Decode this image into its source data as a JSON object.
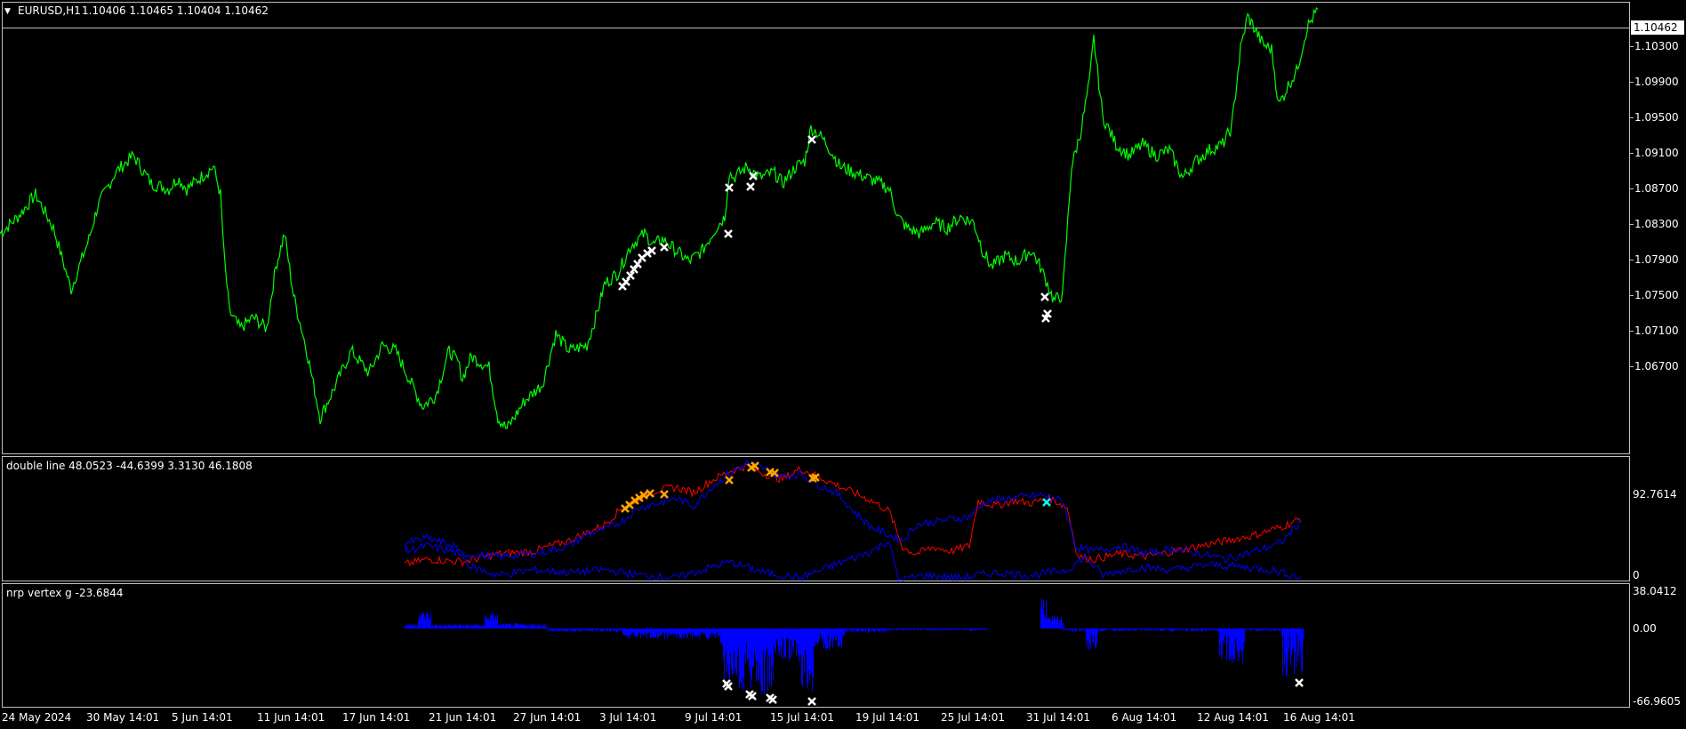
{
  "header": {
    "symbol_timeframe": "EURUSD,H1",
    "ohlc": "1.10406 1.10465 1.10404 1.10462"
  },
  "main_pane": {
    "current_price": "1.10462",
    "price_axis": [
      "1.10300",
      "1.09900",
      "1.09500",
      "1.09100",
      "1.08700",
      "1.08300",
      "1.07900",
      "1.07500",
      "1.07100",
      "1.06700"
    ],
    "line_color": "#00ff00"
  },
  "indicator1": {
    "title": "double line 48.0523 -44.6399 3.3130 46.1808",
    "axis_max": "92.7614",
    "axis_min": "0",
    "colors": {
      "red": "#ff0000",
      "blue": "#0000ff",
      "marker": "#ffa500",
      "cyan_marker": "#00ffff"
    }
  },
  "indicator2": {
    "title": "nrp vertex g -23.6844",
    "axis_max": "38.0412",
    "axis_mid": "0.00",
    "axis_min": "-66.9605",
    "histogram_color": "#0000ff"
  },
  "time_axis": [
    "24 May 2024",
    "30 May 14:01",
    "5 Jun 14:01",
    "11 Jun 14:01",
    "17 Jun 14:01",
    "21 Jun 14:01",
    "27 Jun 14:01",
    "3 Jul 14:01",
    "9 Jul 14:01",
    "15 Jul 14:01",
    "19 Jul 14:01",
    "25 Jul 14:01",
    "31 Jul 14:01",
    "6 Aug 14:01",
    "12 Aug 14:01",
    "16 Aug 14:01"
  ],
  "chart_data": [
    {
      "type": "line",
      "title": "EURUSD,H1",
      "ylim": [
        1.0648,
        1.1052
      ],
      "x": [
        "24 May 2024",
        "30 May 14:01",
        "5 Jun 14:01",
        "11 Jun 14:01",
        "17 Jun 14:01",
        "21 Jun 14:01",
        "27 Jun 14:01",
        "3 Jul 14:01",
        "9 Jul 14:01",
        "15 Jul 14:01",
        "19 Jul 14:01",
        "25 Jul 14:01",
        "31 Jul 14:01",
        "6 Aug 14:01",
        "12 Aug 14:01",
        "16 Aug 14:01"
      ],
      "series": [
        {
          "values": [
            1.0845,
            1.088,
            1.089,
            1.085,
            1.07,
            1.072,
            1.07,
            1.082,
            1.086,
            1.094,
            1.088,
            1.085,
            1.08,
            1.092,
            1.093,
            1.1046
          ]
        }
      ],
      "price_points": [
        [
          0,
          1.0845
        ],
        [
          20,
          1.086
        ],
        [
          40,
          1.088
        ],
        [
          60,
          1.085
        ],
        [
          80,
          1.0795
        ],
        [
          100,
          1.084
        ],
        [
          110,
          1.087
        ],
        [
          130,
          1.09
        ],
        [
          150,
          1.0915
        ],
        [
          170,
          1.089
        ],
        [
          190,
          1.0885
        ],
        [
          200,
          1.0895
        ],
        [
          210,
          1.0885
        ],
        [
          240,
          1.0905
        ],
        [
          248,
          1.088
        ],
        [
          252,
          1.0825
        ],
        [
          258,
          1.0775
        ],
        [
          270,
          1.076
        ],
        [
          285,
          1.077
        ],
        [
          300,
          1.076
        ],
        [
          310,
          1.0815
        ],
        [
          320,
          1.0845
        ],
        [
          330,
          1.079
        ],
        [
          345,
          1.074
        ],
        [
          360,
          1.068
        ],
        [
          375,
          1.0705
        ],
        [
          395,
          1.074
        ],
        [
          415,
          1.072
        ],
        [
          430,
          1.0745
        ],
        [
          445,
          1.074
        ],
        [
          460,
          1.0715
        ],
        [
          475,
          1.069
        ],
        [
          490,
          1.07
        ],
        [
          505,
          1.074
        ],
        [
          515,
          1.073
        ],
        [
          520,
          1.0715
        ],
        [
          530,
          1.0735
        ],
        [
          550,
          1.0725
        ],
        [
          560,
          1.068
        ],
        [
          570,
          1.067
        ],
        [
          590,
          1.0695
        ],
        [
          610,
          1.071
        ],
        [
          625,
          1.0755
        ],
        [
          640,
          1.074
        ],
        [
          660,
          1.0745
        ],
        [
          670,
          1.077
        ],
        [
          680,
          1.08
        ],
        [
          695,
          1.081
        ],
        [
          710,
          1.0835
        ],
        [
          725,
          1.0845
        ],
        [
          735,
          1.0835
        ],
        [
          745,
          1.084
        ],
        [
          760,
          1.083
        ],
        [
          775,
          1.082
        ],
        [
          790,
          1.083
        ],
        [
          805,
          1.085
        ],
        [
          815,
          1.086
        ],
        [
          820,
          1.09
        ],
        [
          825,
          1.0895
        ],
        [
          840,
          1.0905
        ],
        [
          855,
          1.0895
        ],
        [
          870,
          1.09
        ],
        [
          880,
          1.089
        ],
        [
          895,
          1.0905
        ],
        [
          905,
          1.091
        ],
        [
          912,
          1.094
        ],
        [
          920,
          1.0935
        ],
        [
          930,
          1.0925
        ],
        [
          945,
          1.0905
        ],
        [
          960,
          1.09
        ],
        [
          975,
          1.0895
        ],
        [
          990,
          1.089
        ],
        [
          1000,
          1.0885
        ],
        [
          1010,
          1.086
        ],
        [
          1020,
          1.085
        ],
        [
          1035,
          1.0845
        ],
        [
          1050,
          1.0855
        ],
        [
          1065,
          1.085
        ],
        [
          1080,
          1.086
        ],
        [
          1095,
          1.0855
        ],
        [
          1105,
          1.083
        ],
        [
          1115,
          1.0815
        ],
        [
          1130,
          1.0825
        ],
        [
          1145,
          1.082
        ],
        [
          1160,
          1.083
        ],
        [
          1170,
          1.0815
        ],
        [
          1178,
          1.08
        ],
        [
          1185,
          1.0785
        ],
        [
          1195,
          1.079
        ],
        [
          1205,
          1.0905
        ],
        [
          1215,
          1.0935
        ],
        [
          1225,
          1.098
        ],
        [
          1230,
          1.102
        ],
        [
          1240,
          1.095
        ],
        [
          1255,
          1.0925
        ],
        [
          1270,
          1.0915
        ],
        [
          1285,
          1.0925
        ],
        [
          1300,
          1.0915
        ],
        [
          1315,
          1.092
        ],
        [
          1330,
          1.0895
        ],
        [
          1345,
          1.091
        ],
        [
          1360,
          1.092
        ],
        [
          1375,
          1.0925
        ],
        [
          1385,
          1.094
        ],
        [
          1395,
          1.101
        ],
        [
          1403,
          1.104
        ],
        [
          1410,
          1.103
        ],
        [
          1420,
          1.1015
        ],
        [
          1430,
          1.101
        ],
        [
          1438,
          1.096
        ],
        [
          1450,
          1.098
        ],
        [
          1458,
          1.099
        ],
        [
          1470,
          1.103
        ],
        [
          1482,
          1.1046
        ]
      ]
    },
    {
      "type": "line",
      "title": "double line 48.0523 -44.6399 3.3130 46.1808",
      "ylim": [
        0,
        92.7614
      ],
      "series": [
        {
          "name": "red",
          "points": [
            [
              455,
              12
            ],
            [
              480,
              16
            ],
            [
              520,
              14
            ],
            [
              560,
              20
            ],
            [
              600,
              22
            ],
            [
              640,
              30
            ],
            [
              680,
              42
            ],
            [
              700,
              55
            ],
            [
              720,
              62
            ],
            [
              740,
              68
            ],
            [
              760,
              70
            ],
            [
              780,
              66
            ],
            [
              800,
              75
            ],
            [
              820,
              82
            ],
            [
              840,
              86
            ],
            [
              860,
              80
            ],
            [
              880,
              76
            ],
            [
              900,
              84
            ],
            [
              920,
              78
            ],
            [
              940,
              72
            ],
            [
              960,
              66
            ],
            [
              980,
              60
            ],
            [
              1000,
              52
            ],
            [
              1015,
              25
            ],
            [
              1030,
              20
            ],
            [
              1050,
              25
            ],
            [
              1070,
              22
            ],
            [
              1090,
              26
            ],
            [
              1100,
              60
            ],
            [
              1120,
              56
            ],
            [
              1140,
              60
            ],
            [
              1160,
              58
            ],
            [
              1180,
              62
            ],
            [
              1200,
              55
            ],
            [
              1212,
              18
            ],
            [
              1230,
              16
            ],
            [
              1260,
              20
            ],
            [
              1290,
              18
            ],
            [
              1320,
              22
            ],
            [
              1350,
              26
            ],
            [
              1380,
              30
            ],
            [
              1410,
              34
            ],
            [
              1440,
              40
            ],
            [
              1465,
              47
            ]
          ]
        },
        {
          "name": "blue",
          "points": [
            [
              455,
              22
            ],
            [
              480,
              26
            ],
            [
              520,
              20
            ],
            [
              560,
              18
            ],
            [
              600,
              20
            ],
            [
              640,
              26
            ],
            [
              660,
              35
            ],
            [
              680,
              38
            ],
            [
              700,
              45
            ],
            [
              720,
              55
            ],
            [
              740,
              58
            ],
            [
              760,
              62
            ],
            [
              780,
              56
            ],
            [
              800,
              70
            ],
            [
              820,
              80
            ],
            [
              840,
              88
            ],
            [
              860,
              84
            ],
            [
              880,
              78
            ],
            [
              900,
              80
            ],
            [
              920,
              72
            ],
            [
              940,
              66
            ],
            [
              960,
              52
            ],
            [
              980,
              40
            ],
            [
              1000,
              34
            ],
            [
              1015,
              30
            ],
            [
              1030,
              42
            ],
            [
              1050,
              44
            ],
            [
              1070,
              46
            ],
            [
              1090,
              48
            ],
            [
              1110,
              60
            ],
            [
              1140,
              62
            ],
            [
              1170,
              64
            ],
            [
              1195,
              60
            ],
            [
              1210,
              25
            ],
            [
              1230,
              22
            ],
            [
              1260,
              26
            ],
            [
              1290,
              20
            ],
            [
              1320,
              24
            ],
            [
              1350,
              20
            ],
            [
              1380,
              16
            ],
            [
              1410,
              22
            ],
            [
              1440,
              28
            ],
            [
              1465,
              46
            ]
          ]
        },
        {
          "name": "blue2",
          "points": [
            [
              455,
              28
            ],
            [
              480,
              32
            ],
            [
              510,
              26
            ],
            [
              530,
              10
            ],
            [
              560,
              4
            ],
            [
              600,
              8
            ],
            [
              640,
              6
            ],
            [
              680,
              8
            ],
            [
              720,
              4
            ],
            [
              760,
              2
            ],
            [
              800,
              10
            ],
            [
              820,
              14
            ],
            [
              860,
              6
            ],
            [
              900,
              2
            ],
            [
              940,
              12
            ],
            [
              980,
              22
            ],
            [
              1000,
              30
            ],
            [
              1010,
              0
            ],
            [
              1040,
              4
            ],
            [
              1080,
              2
            ],
            [
              1120,
              6
            ],
            [
              1160,
              4
            ],
            [
              1200,
              8
            ],
            [
              1220,
              18
            ],
            [
              1240,
              4
            ],
            [
              1280,
              10
            ],
            [
              1320,
              8
            ],
            [
              1360,
              12
            ],
            [
              1400,
              10
            ],
            [
              1430,
              8
            ],
            [
              1465,
              2
            ]
          ]
        }
      ]
    },
    {
      "type": "bar",
      "title": "nrp vertex g -23.6844",
      "ylim": [
        -66.9605,
        38.0412
      ]
    }
  ]
}
